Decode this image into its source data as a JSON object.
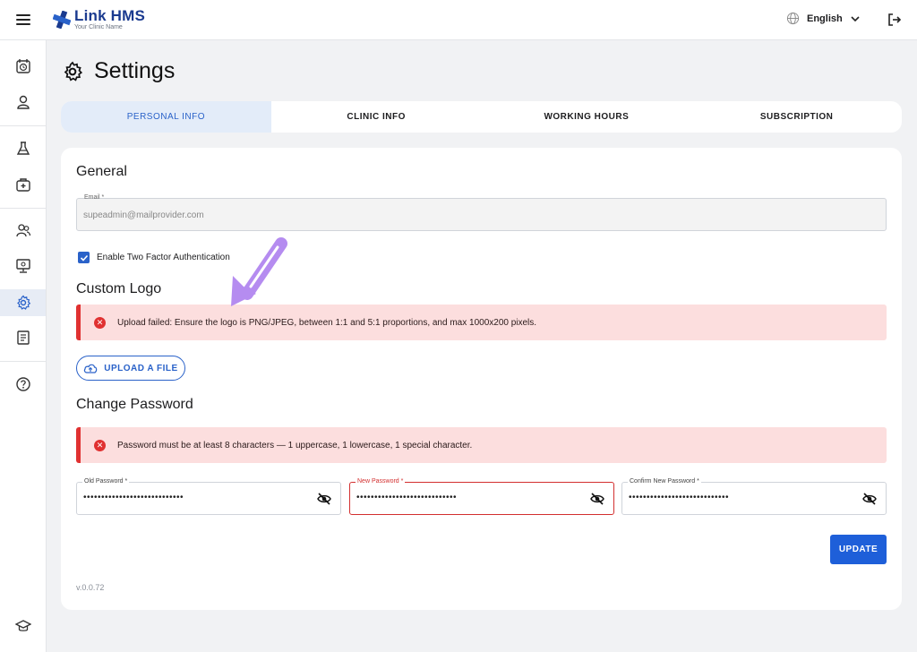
{
  "header": {
    "app_name": "Link HMS",
    "clinic_name": "Your Clinic Name",
    "language": "English"
  },
  "sidebar": {
    "items": [
      {
        "icon": "calendar-clock-icon"
      },
      {
        "icon": "user-icon"
      },
      {
        "icon": "flask-icon"
      },
      {
        "icon": "medical-kit-icon"
      },
      {
        "icon": "users-icon"
      },
      {
        "icon": "monitor-icon"
      },
      {
        "icon": "gear-icon",
        "active": true
      },
      {
        "icon": "report-icon"
      },
      {
        "icon": "help-icon"
      },
      {
        "icon": "graduation-cap-icon"
      }
    ]
  },
  "page": {
    "title": "Settings"
  },
  "tabs": [
    {
      "label": "PERSONAL INFO",
      "active": true
    },
    {
      "label": "CLINIC INFO"
    },
    {
      "label": "WORKING HOURS"
    },
    {
      "label": "SUBSCRIPTION"
    }
  ],
  "general": {
    "title": "General",
    "email_label": "Email *",
    "email_value": "supeadmin@mailprovider.com",
    "two_factor_label": "Enable Two Factor Authentication",
    "two_factor_checked": true
  },
  "custom_logo": {
    "title": "Custom Logo",
    "error": "Upload failed: Ensure the logo is PNG/JPEG, between 1:1 and 5:1 proportions, and max 1000x200 pixels.",
    "upload_label": "UPLOAD A FILE"
  },
  "change_password": {
    "title": "Change Password",
    "error": "Password must be at least 8 characters — 1 uppercase, 1 lowercase, 1 special character.",
    "old_label": "Old Password *",
    "old_value": "••••••••••••••••••••••••••••",
    "new_label": "New Password *",
    "new_value": "••••••••••••••••••••••••••••",
    "confirm_label": "Confirm New Password *",
    "confirm_value": "••••••••••••••••••••••••••••",
    "update_label": "UPDATE"
  },
  "footer": {
    "version": "v.0.0.72"
  },
  "colors": {
    "primary": "#1e5fd9",
    "error": "#e03131",
    "error_bg": "#fcdede",
    "annotation": "#b58cf0"
  }
}
